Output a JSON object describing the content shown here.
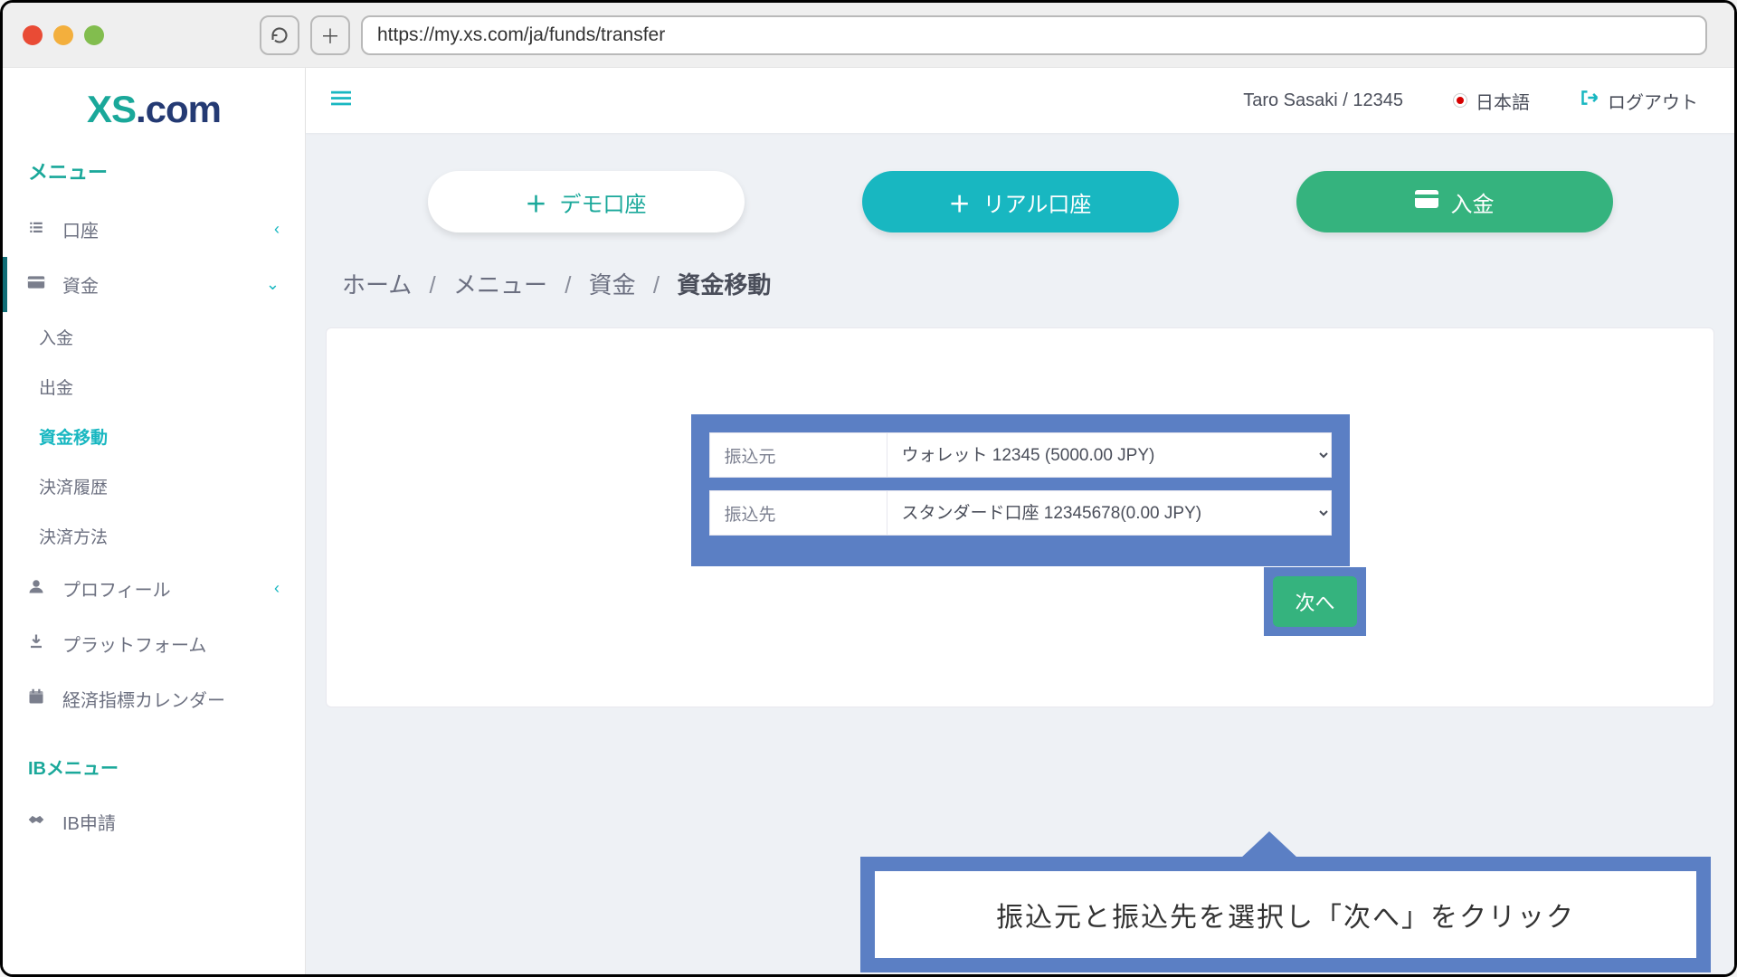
{
  "browser": {
    "url": "https://my.xs.com/ja/funds/transfer"
  },
  "logo": {
    "xs": "XS",
    "dotcom": ".com"
  },
  "sidebar": {
    "menu_header": "メニュー",
    "items": {
      "accounts": "口座",
      "funds": "資金",
      "profile": "プロフィール",
      "platform": "プラットフォーム",
      "calendar": "経済指標カレンダー"
    },
    "funds_sub": {
      "deposit": "入金",
      "withdraw": "出金",
      "transfer": "資金移動",
      "history": "決済履歴",
      "methods": "決済方法"
    },
    "ib_header": "IBメニュー",
    "ib_apply": "IB申請"
  },
  "topbar": {
    "user": "Taro Sasaki / 12345",
    "lang": "日本語",
    "logout": "ログアウト"
  },
  "actions": {
    "demo": "デモ口座",
    "real": "リアル口座",
    "deposit": "入金"
  },
  "breadcrumb": {
    "home": "ホーム",
    "menu": "メニュー",
    "funds": "資金",
    "current": "資金移動"
  },
  "form": {
    "from_label": "振込元",
    "from_value": "ウォレット 12345 (5000.00 JPY)",
    "to_label": "振込先",
    "to_value": "スタンダード口座 12345678(0.00 JPY)",
    "next": "次へ"
  },
  "callout": "振込元と振込先を選択し「次へ」をクリック"
}
